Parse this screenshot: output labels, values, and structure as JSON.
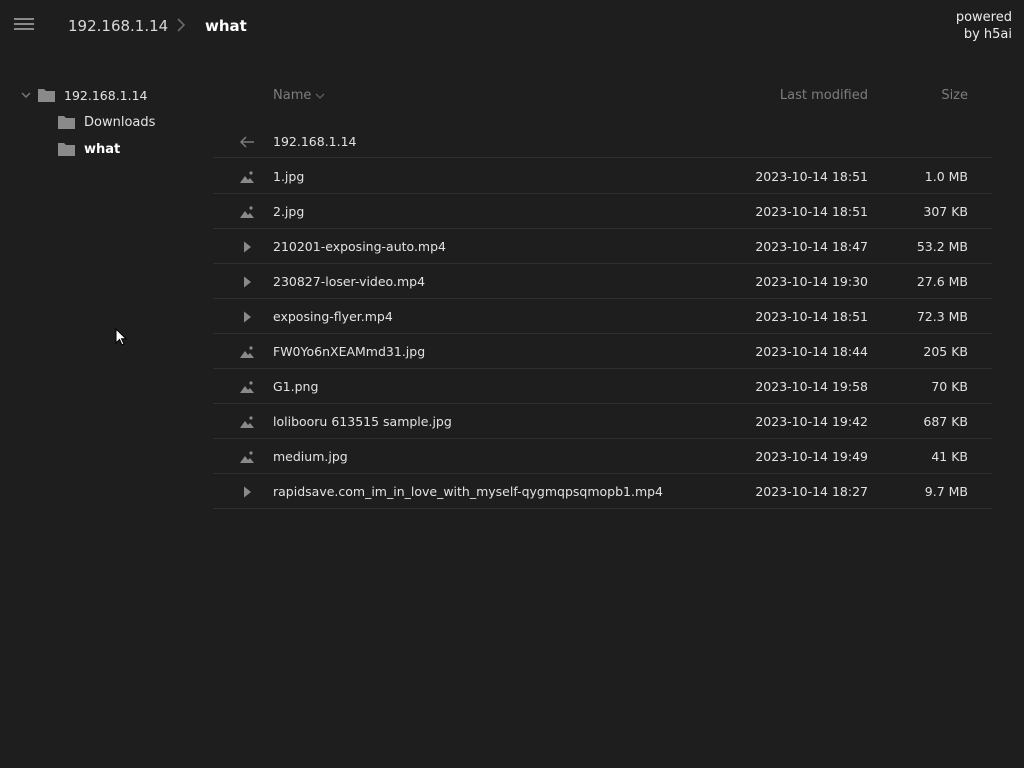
{
  "header": {
    "breadcrumb_root": "192.168.1.14",
    "breadcrumb_current": "what",
    "powered_line1": "powered",
    "powered_line2": "by h5ai"
  },
  "tree": {
    "root": "192.168.1.14",
    "children": [
      "Downloads",
      "what"
    ]
  },
  "columns": {
    "name": "Name",
    "modified": "Last modified",
    "size": "Size"
  },
  "parent": {
    "label": "192.168.1.14"
  },
  "files": [
    {
      "icon": "image-icon",
      "name": "1.jpg",
      "modified": "2023-10-14 18:51",
      "size": "1.0 MB"
    },
    {
      "icon": "image-icon",
      "name": "2.jpg",
      "modified": "2023-10-14 18:51",
      "size": "307 KB"
    },
    {
      "icon": "play-icon",
      "name": "210201-exposing-auto.mp4",
      "modified": "2023-10-14 18:47",
      "size": "53.2 MB"
    },
    {
      "icon": "play-icon",
      "name": "230827-loser-video.mp4",
      "modified": "2023-10-14 19:30",
      "size": "27.6 MB"
    },
    {
      "icon": "play-icon",
      "name": "exposing-flyer.mp4",
      "modified": "2023-10-14 18:51",
      "size": "72.3 MB"
    },
    {
      "icon": "image-icon",
      "name": "FW0Yo6nXEAMmd31.jpg",
      "modified": "2023-10-14 18:44",
      "size": "205 KB"
    },
    {
      "icon": "image-icon",
      "name": "G1.png",
      "modified": "2023-10-14 19:58",
      "size": "70 KB"
    },
    {
      "icon": "image-icon",
      "name": "lolibooru 613515 sample.jpg",
      "modified": "2023-10-14 19:42",
      "size": "687 KB"
    },
    {
      "icon": "image-icon",
      "name": "medium.jpg",
      "modified": "2023-10-14 19:49",
      "size": "41 KB"
    },
    {
      "icon": "play-icon",
      "name": "rapidsave.com_im_in_love_with_myself-qygmqpsqmopb1.mp4",
      "modified": "2023-10-14 18:27",
      "size": "9.7 MB"
    }
  ],
  "colors": {
    "background": "#1e1e1f",
    "row_divider": "#2f2f30",
    "icon": "#8a8a8a",
    "text": "#e2e2e2",
    "muted": "#7d7d7d"
  }
}
